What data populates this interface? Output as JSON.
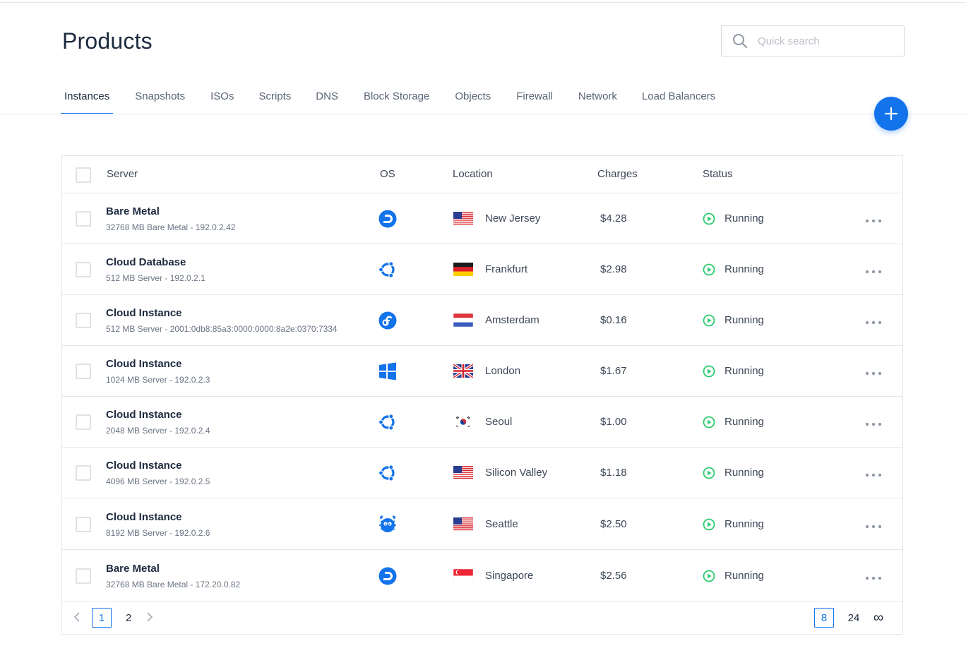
{
  "header": {
    "title": "Products",
    "search_placeholder": "Quick search"
  },
  "tabs": [
    {
      "label": "Instances",
      "active": true
    },
    {
      "label": "Snapshots"
    },
    {
      "label": "ISOs"
    },
    {
      "label": "Scripts"
    },
    {
      "label": "DNS"
    },
    {
      "label": "Block Storage"
    },
    {
      "label": "Objects"
    },
    {
      "label": "Firewall"
    },
    {
      "label": "Network"
    },
    {
      "label": "Load Balancers"
    }
  ],
  "add_button_icon": "plus-icon",
  "table": {
    "headers": {
      "server": "Server",
      "os": "OS",
      "location": "Location",
      "charges": "Charges",
      "status": "Status"
    },
    "rows": [
      {
        "name": "Bare Metal",
        "detail": "32768 MB Bare Metal - 192.0.2.42",
        "os": "debian",
        "flag": "us",
        "location": "New Jersey",
        "charges": "$4.28",
        "status": "Running"
      },
      {
        "name": "Cloud Database",
        "detail": "512 MB Server - 192.0.2.1",
        "os": "ubuntu",
        "flag": "de",
        "location": "Frankfurt",
        "charges": "$2.98",
        "status": "Running"
      },
      {
        "name": "Cloud Instance",
        "detail": "512 MB Server - 2001:0db8:85a3:0000:0000:8a2e:0370:7334",
        "os": "fedora",
        "flag": "nl",
        "location": "Amsterdam",
        "charges": "$0.16",
        "status": "Running"
      },
      {
        "name": "Cloud Instance",
        "detail": "1024 MB Server - 192.0.2.3",
        "os": "windows",
        "flag": "gb",
        "location": "London",
        "charges": "$1.67",
        "status": "Running"
      },
      {
        "name": "Cloud Instance",
        "detail": "2048 MB Server - 192.0.2.4",
        "os": "ubuntu",
        "flag": "kr",
        "location": "Seoul",
        "charges": "$1.00",
        "status": "Running"
      },
      {
        "name": "Cloud Instance",
        "detail": "4096 MB Server - 192.0.2.5",
        "os": "ubuntu",
        "flag": "us",
        "location": "Silicon Valley",
        "charges": "$1.18",
        "status": "Running"
      },
      {
        "name": "Cloud Instance",
        "detail": "8192 MB Server - 192.0.2.6",
        "os": "freebsd",
        "flag": "us",
        "location": "Seattle",
        "charges": "$2.50",
        "status": "Running"
      },
      {
        "name": "Bare Metal",
        "detail": "32768 MB Bare Metal - 172.20.0.82",
        "os": "debian",
        "flag": "sg",
        "location": "Singapore",
        "charges": "$2.56",
        "status": "Running"
      }
    ]
  },
  "pagination": {
    "pages": [
      "1",
      "2"
    ],
    "current_page": "1",
    "page_sizes": [
      "8",
      "24",
      "∞"
    ],
    "current_size": "8"
  },
  "colors": {
    "accent": "#1273eb",
    "status_running": "#2ecc71"
  }
}
